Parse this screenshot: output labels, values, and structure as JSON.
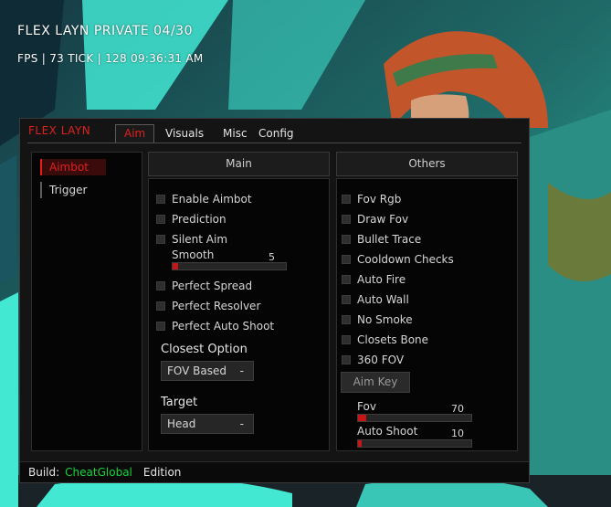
{
  "hud": {
    "title": "FLEX LAYN PRIVATE  04/30",
    "stats": "FPS | 73  TICK | 128  09:36:31 AM"
  },
  "menu": {
    "brand": "FLEX LAYN",
    "tabs": [
      {
        "label": "Aim",
        "active": true
      },
      {
        "label": "Visuals"
      },
      {
        "label": "Misc"
      },
      {
        "label": "Config"
      }
    ],
    "nav": [
      {
        "label": "Aimbot",
        "active": true
      },
      {
        "label": "Trigger"
      }
    ]
  },
  "main_panel": {
    "title": "Main",
    "checkboxes": [
      "Enable Aimbot",
      "Prediction",
      "Silent Aim"
    ],
    "smooth": {
      "label": "Smooth",
      "value": 5,
      "max": 100
    },
    "checkboxes2": [
      "Perfect Spread",
      "Perfect Resolver",
      "Perfect Auto Shoot"
    ],
    "closest_option": {
      "label": "Closest Option",
      "value": "FOV Based",
      "caret": "-"
    },
    "target": {
      "label": "Target",
      "value": "Head",
      "caret": "-"
    }
  },
  "others_panel": {
    "title": "Others",
    "checkboxes": [
      "Fov Rgb",
      "Draw Fov",
      "Bullet Trace",
      "Cooldown Checks",
      "Auto Fire",
      "Auto Wall",
      "No Smoke",
      "Closets Bone",
      "360 FOV"
    ],
    "aim_key_label": "Aim Key",
    "fov": {
      "label": "Fov",
      "value": 70,
      "max": 1000
    },
    "auto_shoot": {
      "label": "Auto Shoot",
      "value": 10,
      "max": 1000
    }
  },
  "footer": {
    "build_label": "Build:",
    "build_name": "CheatGlobal",
    "edition": "Edition"
  },
  "colors": {
    "accent_red": "#e0201f",
    "build_green": "#16d43a"
  }
}
